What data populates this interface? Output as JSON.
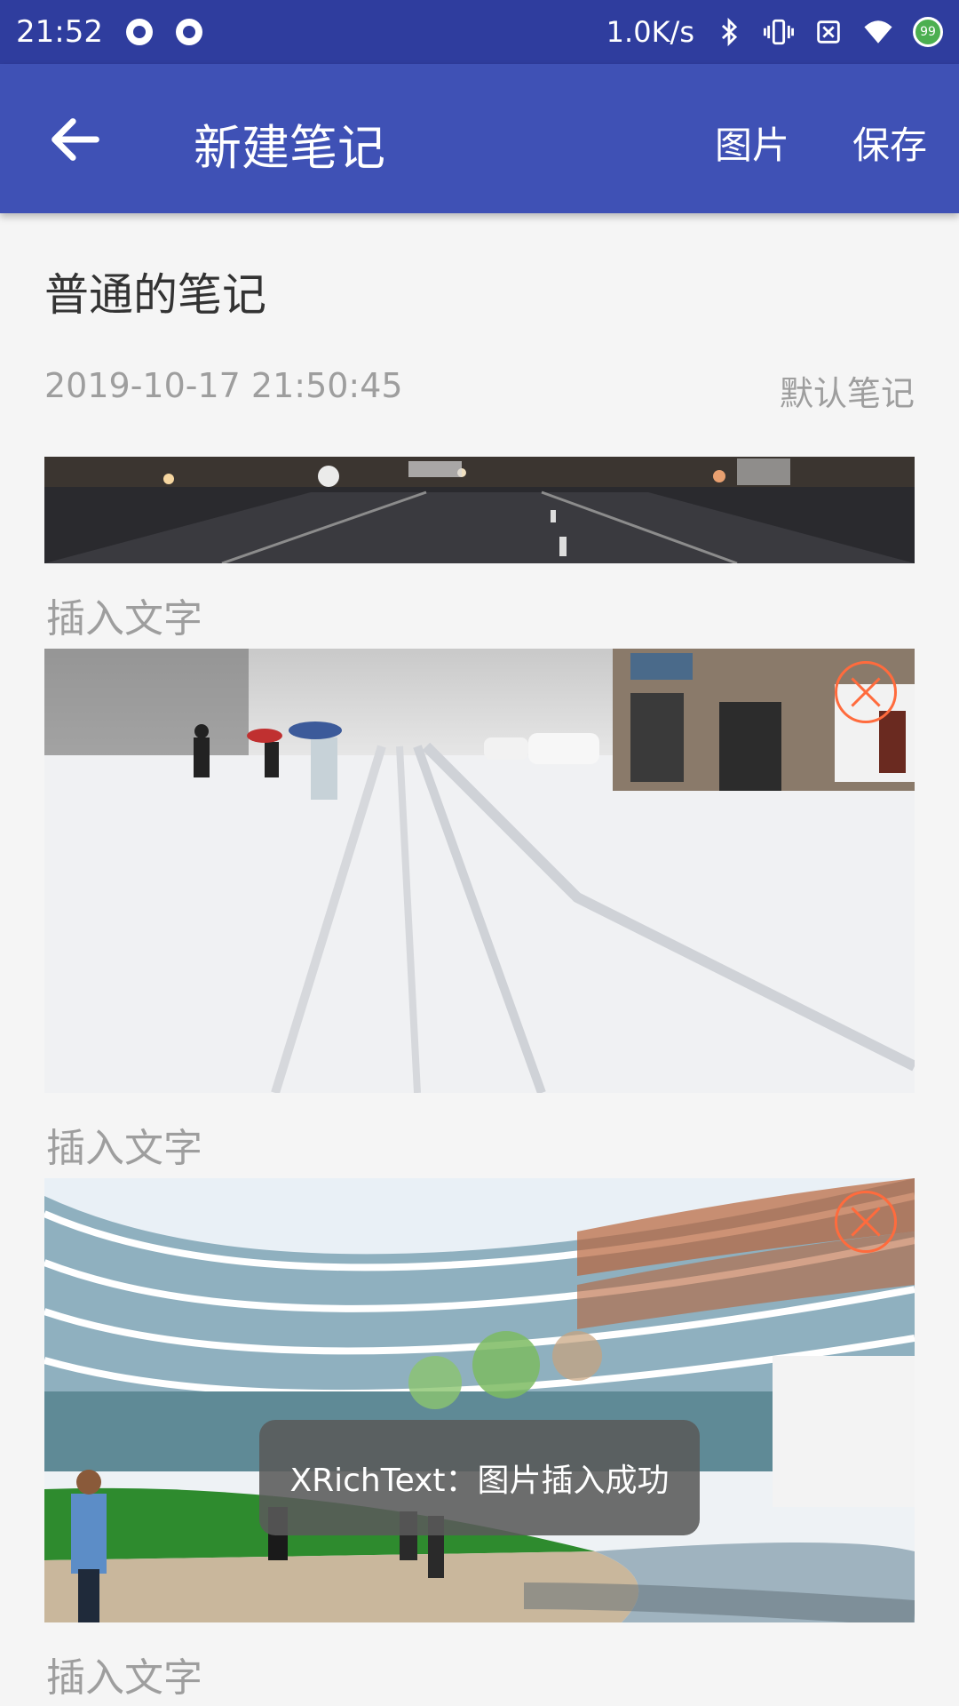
{
  "status_bar": {
    "time": "21:52",
    "network_speed": "1.0K/s",
    "battery_level": "99",
    "icons": [
      "notification-icon",
      "notification-icon",
      "bluetooth-icon",
      "vibrate-icon",
      "no-sim-icon",
      "wifi-icon",
      "battery-icon"
    ]
  },
  "app_bar": {
    "title": "新建笔记",
    "image_action": "图片",
    "save_action": "保存",
    "colors": {
      "primary": "#3f51b5",
      "primary_dark": "#2f3d9e"
    }
  },
  "note": {
    "title": "普通的笔记",
    "datetime": "2019-10-17 21:50:45",
    "category": "默认笔记",
    "insert_placeholder_1": "插入文字",
    "insert_placeholder_2": "插入文字",
    "insert_placeholder_3": "插入文字"
  },
  "toast": {
    "message": "XRichText：图片插入成功"
  },
  "accent": {
    "delete": "#ff6b3d"
  }
}
